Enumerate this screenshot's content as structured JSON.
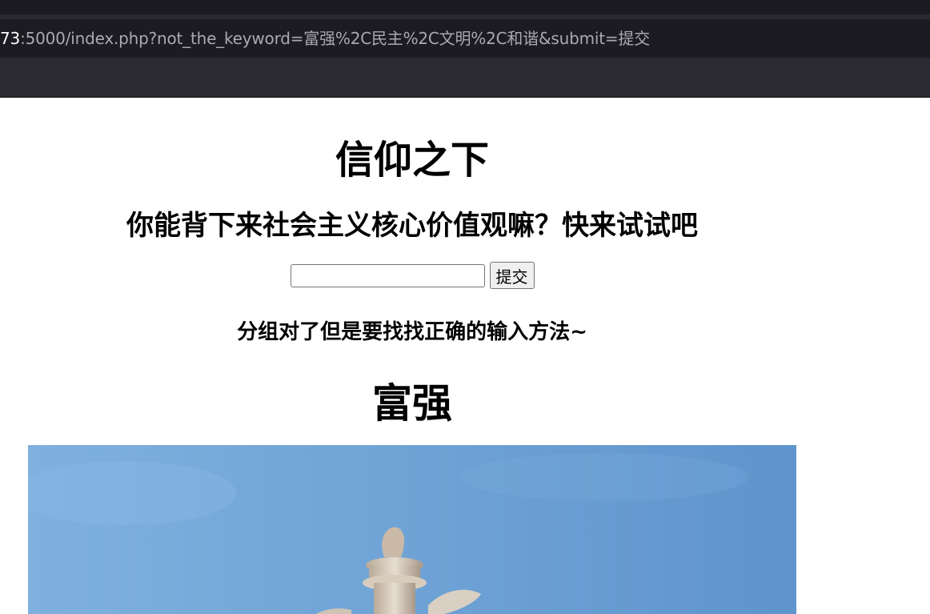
{
  "browser": {
    "url_host_fragment": "73",
    "url_rest": ":5000/index.php?not_the_keyword=富强%2C民主%2C文明%2C和谐&submit=提交"
  },
  "page": {
    "title": "信仰之下",
    "question": "你能背下来社会主义核心价值观嘛？快来试试吧",
    "input": {
      "value": "",
      "placeholder": ""
    },
    "submit_label": "提交",
    "hint": "分组对了但是要找找正确的输入方法~",
    "section_title": "富强"
  },
  "colors": {
    "browser_chrome": "#2b2a33",
    "url_field": "#1c1b22",
    "url_text": "#a9a9ae",
    "page_background": "#ffffff"
  }
}
